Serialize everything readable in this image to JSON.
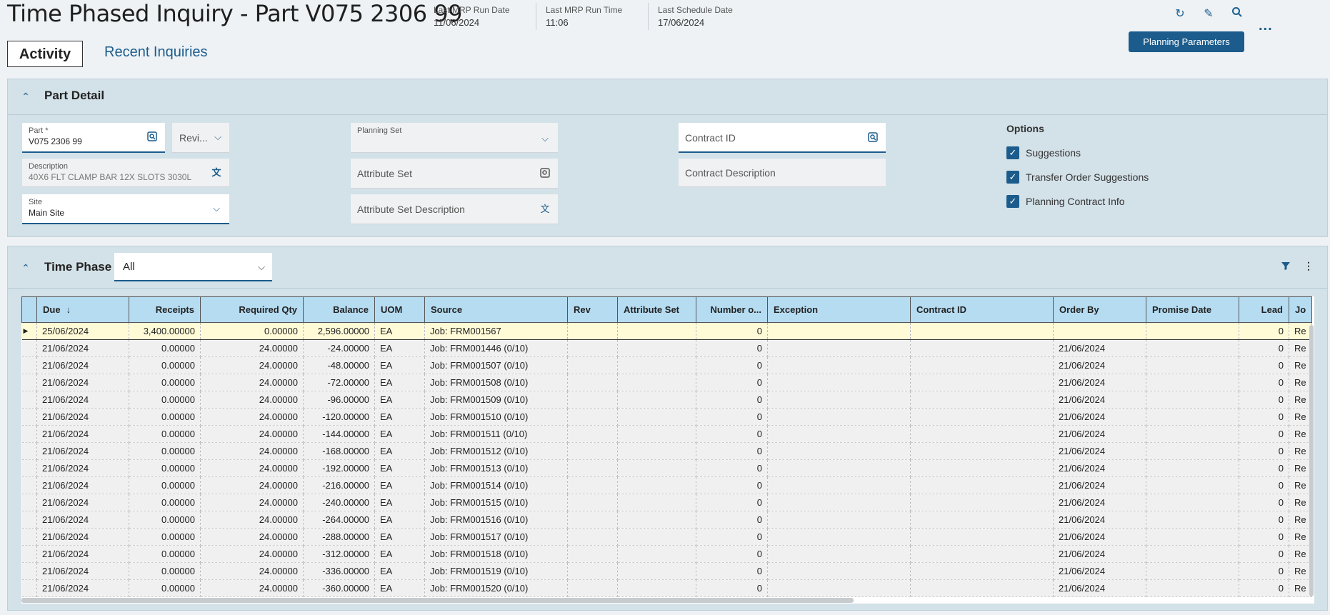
{
  "header": {
    "title": "Time Phased Inquiry - Part V075 2306 99",
    "info": [
      {
        "label": "Last MRP Run Date",
        "value": "11/06/2024"
      },
      {
        "label": "Last MRP Run Time",
        "value": "11:06"
      },
      {
        "label": "Last Schedule Date",
        "value": "17/06/2024"
      }
    ],
    "planning_parameters_label": "Planning Parameters",
    "more_label": "..."
  },
  "tabs": {
    "activity": "Activity",
    "recent": "Recent Inquiries"
  },
  "part_detail": {
    "title": "Part Detail",
    "part_label": "Part *",
    "part_value": "V075 2306 99",
    "revision_placeholder": "Revi...",
    "description_label": "Description",
    "description_value": "40X6 FLT CLAMP BAR 12X SLOTS 3030L",
    "site_label": "Site",
    "site_value": "Main Site",
    "planning_set_label": "Planning Set",
    "attribute_set_placeholder": "Attribute Set",
    "attribute_set_desc_placeholder": "Attribute Set Description",
    "contract_id_placeholder": "Contract ID",
    "contract_desc_placeholder": "Contract Description",
    "options_title": "Options",
    "options": [
      "Suggestions",
      "Transfer Order Suggestions",
      "Planning Contract Info"
    ]
  },
  "time_phase": {
    "title": "Time Phase",
    "filter_value": "All",
    "columns": [
      "Due",
      "Receipts",
      "Required Qty",
      "Balance",
      "UOM",
      "Source",
      "Rev",
      "Attribute Set",
      "Number o...",
      "Exception",
      "Contract ID",
      "Order By",
      "Promise Date",
      "Lead",
      "Jo"
    ],
    "rows": [
      [
        "25/06/2024",
        "3,400.00000",
        "0.00000",
        "2,596.00000",
        "EA",
        "Job: FRM001567",
        "",
        "",
        "0",
        "",
        "",
        "",
        "",
        "0",
        "Re"
      ],
      [
        "21/06/2024",
        "0.00000",
        "24.00000",
        "-24.00000",
        "EA",
        "Job: FRM001446 (0/10)",
        "",
        "",
        "0",
        "",
        "",
        "21/06/2024",
        "",
        "0",
        "Re"
      ],
      [
        "21/06/2024",
        "0.00000",
        "24.00000",
        "-48.00000",
        "EA",
        "Job: FRM001507 (0/10)",
        "",
        "",
        "0",
        "",
        "",
        "21/06/2024",
        "",
        "0",
        "Re"
      ],
      [
        "21/06/2024",
        "0.00000",
        "24.00000",
        "-72.00000",
        "EA",
        "Job: FRM001508 (0/10)",
        "",
        "",
        "0",
        "",
        "",
        "21/06/2024",
        "",
        "0",
        "Re"
      ],
      [
        "21/06/2024",
        "0.00000",
        "24.00000",
        "-96.00000",
        "EA",
        "Job: FRM001509 (0/10)",
        "",
        "",
        "0",
        "",
        "",
        "21/06/2024",
        "",
        "0",
        "Re"
      ],
      [
        "21/06/2024",
        "0.00000",
        "24.00000",
        "-120.00000",
        "EA",
        "Job: FRM001510 (0/10)",
        "",
        "",
        "0",
        "",
        "",
        "21/06/2024",
        "",
        "0",
        "Re"
      ],
      [
        "21/06/2024",
        "0.00000",
        "24.00000",
        "-144.00000",
        "EA",
        "Job: FRM001511 (0/10)",
        "",
        "",
        "0",
        "",
        "",
        "21/06/2024",
        "",
        "0",
        "Re"
      ],
      [
        "21/06/2024",
        "0.00000",
        "24.00000",
        "-168.00000",
        "EA",
        "Job: FRM001512 (0/10)",
        "",
        "",
        "0",
        "",
        "",
        "21/06/2024",
        "",
        "0",
        "Re"
      ],
      [
        "21/06/2024",
        "0.00000",
        "24.00000",
        "-192.00000",
        "EA",
        "Job: FRM001513 (0/10)",
        "",
        "",
        "0",
        "",
        "",
        "21/06/2024",
        "",
        "0",
        "Re"
      ],
      [
        "21/06/2024",
        "0.00000",
        "24.00000",
        "-216.00000",
        "EA",
        "Job: FRM001514 (0/10)",
        "",
        "",
        "0",
        "",
        "",
        "21/06/2024",
        "",
        "0",
        "Re"
      ],
      [
        "21/06/2024",
        "0.00000",
        "24.00000",
        "-240.00000",
        "EA",
        "Job: FRM001515 (0/10)",
        "",
        "",
        "0",
        "",
        "",
        "21/06/2024",
        "",
        "0",
        "Re"
      ],
      [
        "21/06/2024",
        "0.00000",
        "24.00000",
        "-264.00000",
        "EA",
        "Job: FRM001516 (0/10)",
        "",
        "",
        "0",
        "",
        "",
        "21/06/2024",
        "",
        "0",
        "Re"
      ],
      [
        "21/06/2024",
        "0.00000",
        "24.00000",
        "-288.00000",
        "EA",
        "Job: FRM001517 (0/10)",
        "",
        "",
        "0",
        "",
        "",
        "21/06/2024",
        "",
        "0",
        "Re"
      ],
      [
        "21/06/2024",
        "0.00000",
        "24.00000",
        "-312.00000",
        "EA",
        "Job: FRM001518 (0/10)",
        "",
        "",
        "0",
        "",
        "",
        "21/06/2024",
        "",
        "0",
        "Re"
      ],
      [
        "21/06/2024",
        "0.00000",
        "24.00000",
        "-336.00000",
        "EA",
        "Job: FRM001519 (0/10)",
        "",
        "",
        "0",
        "",
        "",
        "21/06/2024",
        "",
        "0",
        "Re"
      ],
      [
        "21/06/2024",
        "0.00000",
        "24.00000",
        "-360.00000",
        "EA",
        "Job: FRM001520 (0/10)",
        "",
        "",
        "0",
        "",
        "",
        "21/06/2024",
        "",
        "0",
        "Re"
      ]
    ]
  },
  "colors": {
    "accent": "#1b5c8c",
    "panel": "#d3e1e8",
    "header_cell": "#b6dcf2",
    "selected_row": "#fffbd7"
  }
}
